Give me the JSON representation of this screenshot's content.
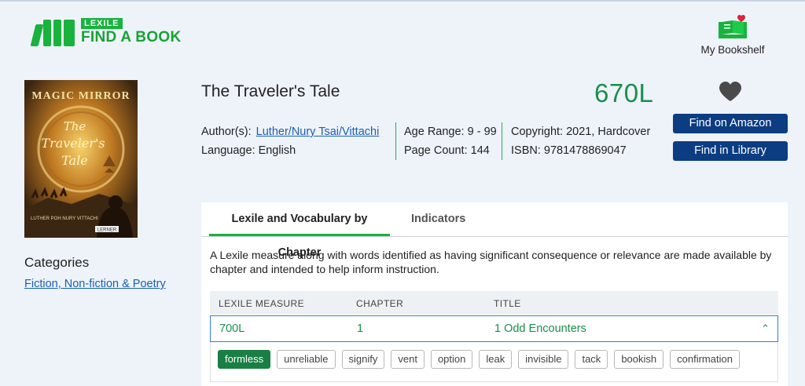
{
  "header": {
    "logo_top": "LEXILE",
    "logo_main": "FIND A BOOK",
    "bookshelf_label": "My Bookshelf",
    "accent": "#17b33d"
  },
  "book": {
    "cover_title_line1": "MAGIC MIRROR",
    "cover_title_line2": "The",
    "cover_title_line3": "Traveler's",
    "cover_title_line4": "Tale",
    "cover_author": "LUTHER POH  NURY VITTACHI",
    "cover_publisher": "LERNER",
    "title": "The Traveler's Tale",
    "lexile": "670L",
    "author_label": "Author(s):",
    "author": "Luther/Nury Tsai/Vittachi",
    "language": "Language: English",
    "age_range": "Age Range: 9 - 99",
    "page_count": "Page Count: 144",
    "copyright": "Copyright: 2021, Hardcover",
    "isbn": "ISBN: 9781478869047",
    "btn_amazon": "Find on Amazon",
    "btn_library": "Find in Library"
  },
  "categories": {
    "title": "Categories",
    "link": "Fiction, Non-fiction & Poetry"
  },
  "panel": {
    "tabs": [
      {
        "label": "Lexile and Vocabulary by Chapter",
        "active": true
      },
      {
        "label": "Indicators",
        "active": false
      }
    ],
    "description": "A Lexile measure along with words identified as having significant consequence or relevance are made available by chapter and intended to help inform instruction.",
    "columns": [
      "LEXILE MEASURE",
      "CHAPTER",
      "TITLE"
    ],
    "rows": [
      {
        "lexile": "700L",
        "chapter": "1",
        "title": "1 Odd Encounters"
      }
    ],
    "words": [
      "formless",
      "unreliable",
      "signify",
      "vent",
      "option",
      "leak",
      "invisible",
      "tack",
      "bookish",
      "confirmation"
    ],
    "active_word": "formless"
  },
  "icons": {
    "bookshelf": "bookshelf-heart-icon",
    "favorite": "heart-icon",
    "expand": "chevron-up-icon"
  }
}
